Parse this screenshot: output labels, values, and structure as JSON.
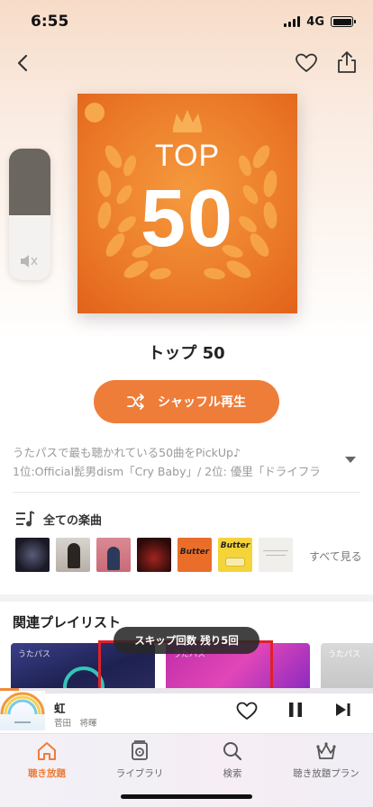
{
  "status_bar": {
    "time": "6:55",
    "network": "4G"
  },
  "nav": {
    "back_icon": "chevron-left-icon",
    "favorite_icon": "heart-icon",
    "share_icon": "share-icon"
  },
  "artwork": {
    "top_text": "TOP",
    "number_text": "50",
    "accent": "#ec7d2a"
  },
  "playlist": {
    "title": "トップ 50",
    "shuffle_label": "シャッフル再生",
    "description_line1": "うたパスで最も聴かれている50曲をPickUp♪",
    "description_line2": "1位:Official髭男dism「Cry Baby」/ 2位: 優里「ドライフラ"
  },
  "all_songs": {
    "label": "全ての楽曲",
    "see_all": "すべて見る",
    "thumbnails": [
      {
        "name": "thumb-1"
      },
      {
        "name": "thumb-2"
      },
      {
        "name": "thumb-3"
      },
      {
        "name": "thumb-4"
      },
      {
        "name": "thumb-5",
        "text": "Butter"
      },
      {
        "name": "thumb-6",
        "text": "Butter"
      },
      {
        "name": "thumb-7"
      }
    ]
  },
  "related": {
    "title": "関連プレイリスト",
    "card_label": "うたパス"
  },
  "toast": {
    "text": "スキップ回数 残り5回"
  },
  "mini_player": {
    "title": "虹",
    "artist": "菅田　将暉",
    "progress": 0.05
  },
  "tabs": [
    {
      "label": "聴き放題",
      "icon": "home-icon",
      "active": true
    },
    {
      "label": "ライブラリ",
      "icon": "library-icon",
      "active": false
    },
    {
      "label": "検索",
      "icon": "search-icon",
      "active": false
    },
    {
      "label": "聴き放題プラン",
      "icon": "crown-icon",
      "active": false
    }
  ],
  "colors": {
    "accent": "#ee7d3a",
    "highlight": "#e0202a"
  }
}
